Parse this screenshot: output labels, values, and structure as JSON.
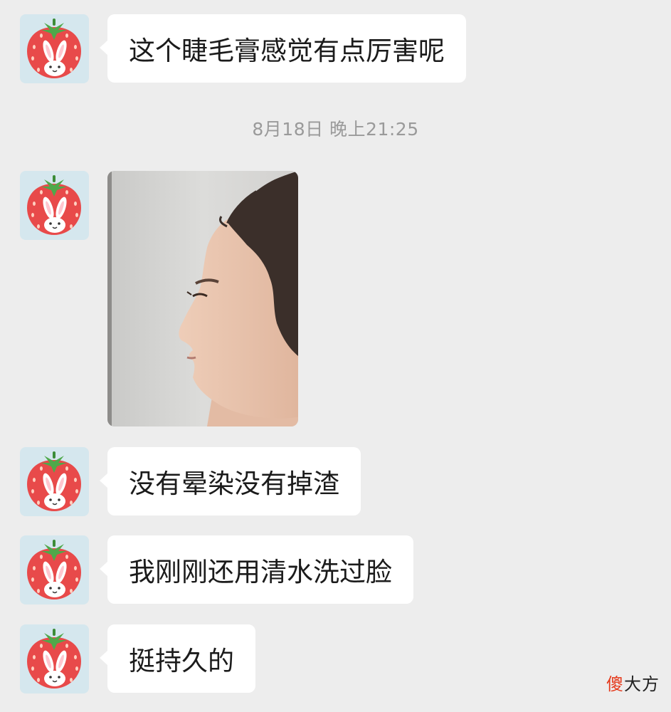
{
  "messages": [
    {
      "text": "这个睫毛膏感觉有点厉害呢"
    },
    {
      "text": "没有晕染没有掉渣"
    },
    {
      "text": "我刚刚还用清水洗过脸"
    },
    {
      "text": "挺持久的"
    }
  ],
  "timestamp": "8月18日 晚上21:25",
  "avatar_icon": "strawberry-bunny-icon",
  "watermark": {
    "first_char": "傻",
    "rest": "大方"
  },
  "colors": {
    "background": "#ededed",
    "bubble": "#ffffff",
    "avatar_bg": "#d5e7ee",
    "strawberry": "#e84a4a",
    "watermark_accent": "#e53a1c"
  }
}
